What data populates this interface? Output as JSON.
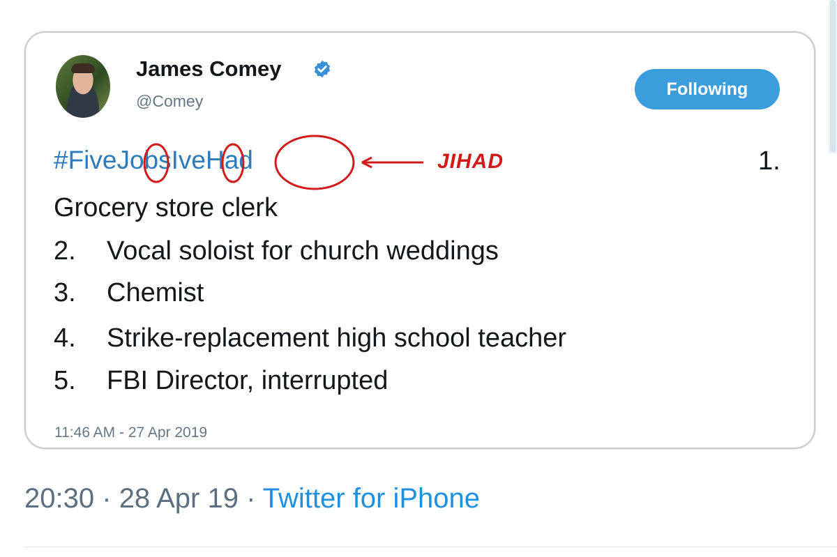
{
  "embedded_tweet": {
    "author_name": "James Comey",
    "author_handle": "@Comey",
    "follow_button_label": "Following",
    "hashtag": "#FiveJobsIveHad",
    "annotation": "JIHAD",
    "first_item_number": "1.",
    "lines": [
      {
        "number": "",
        "text": "Grocery store clerk"
      },
      {
        "number": "2.",
        "text": "Vocal soloist for church weddings"
      },
      {
        "number": "3.",
        "text": "Chemist"
      },
      {
        "number": "4.",
        "text": "Strike-replacement high school teacher"
      },
      {
        "number": "5.",
        "text": "FBI Director, interrupted"
      }
    ],
    "timestamp": "11:46 AM - 27 Apr 2019"
  },
  "tweet_meta": {
    "time": "20:30",
    "separator": "·",
    "date": "28 Apr 19",
    "source": "Twitter for iPhone"
  },
  "colors": {
    "link_blue": "#1d90e0",
    "follow_button": "#3c9ddd",
    "annotation_red": "#d11a1a",
    "verified_badge": "#3a8fd9"
  },
  "icons": [
    "verified-badge-icon",
    "avatar"
  ]
}
